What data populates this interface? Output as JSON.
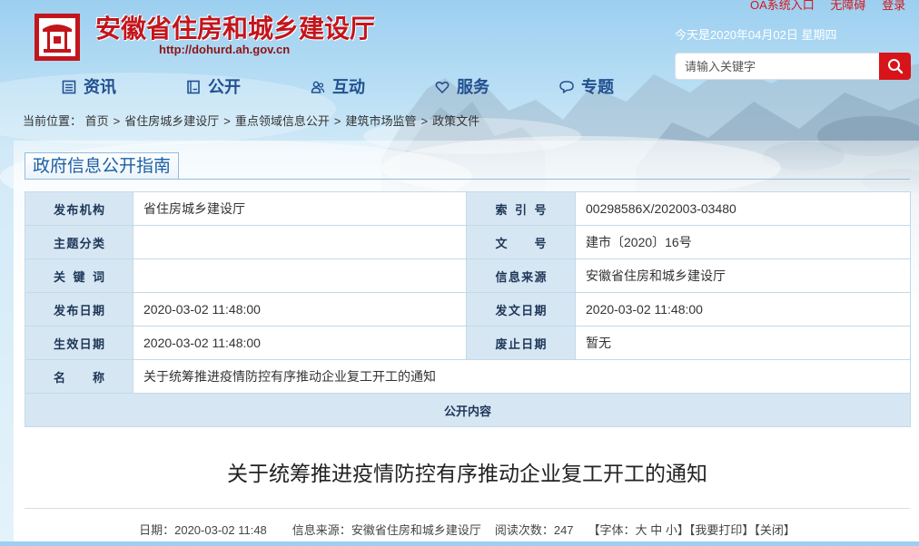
{
  "header": {
    "site_title": "安徽省住房和城乡建设厅",
    "site_url": "http://dohurd.ah.gov.cn",
    "logo_icon": "department-seal-logo",
    "top_links": [
      {
        "label": "OA系统入口"
      },
      {
        "label": "无障碍"
      },
      {
        "label": "登录"
      }
    ],
    "date_text": "今天是2020年04月02日 星期四",
    "search": {
      "placeholder": "请输入关键字",
      "button_icon": "search-icon"
    }
  },
  "nav": [
    {
      "label": "资讯",
      "icon": "list-icon"
    },
    {
      "label": "公开",
      "icon": "book-icon"
    },
    {
      "label": "互动",
      "icon": "people-icon"
    },
    {
      "label": "服务",
      "icon": "heart-icon"
    },
    {
      "label": "专题",
      "icon": "chat-icon"
    }
  ],
  "breadcrumb": {
    "prefix": "当前位置：",
    "separator": ">",
    "items": [
      "首页",
      "省住房城乡建设厅",
      "重点领域信息公开",
      "建筑市场监管",
      "政策文件"
    ]
  },
  "guide": {
    "tab_label": "政府信息公开指南",
    "rows": [
      {
        "label": "发布机构",
        "value": "省住房城乡建设厅",
        "label2": "索 引 号",
        "value2": "00298586X/202003-03480"
      },
      {
        "label": "主题分类",
        "value": "",
        "label2": "文 号",
        "value2": "建市〔2020〕16号"
      },
      {
        "label": "关 键 词",
        "value": "",
        "label2": "信息来源",
        "value2": "安徽省住房和城乡建设厅"
      },
      {
        "label": "发布日期",
        "value": "2020-03-02 11:48:00",
        "label2": "发文日期",
        "value2": "2020-03-02 11:48:00"
      },
      {
        "label": "生效日期",
        "value": "2020-03-02 11:48:00",
        "label2": "废止日期",
        "value2": "暂无"
      }
    ],
    "name_row": {
      "label": "名 称",
      "value": "关于统筹推进疫情防控有序推动企业复工开工的通知"
    },
    "content_label": "公开内容"
  },
  "article": {
    "title": "关于统筹推进疫情防控有序推动企业复工开工的通知",
    "meta": {
      "date_label": "日期：",
      "date": "2020-03-02 11:48",
      "source_label": "信息来源：",
      "source": "安徽省住房和城乡建设厅",
      "views_label": "阅读次数：",
      "views": "247",
      "font_open": "【字体：",
      "font_sizes": [
        "大",
        "中",
        "小"
      ],
      "font_close": "】",
      "print": "【我要打印】",
      "close": "【关闭】"
    }
  },
  "colors": {
    "brand_red": "#c3151c",
    "nav_blue": "#22508f",
    "label_bg": "#d6e7f3",
    "search_button": "#d7141a",
    "tab_text": "#1b5fa4"
  }
}
